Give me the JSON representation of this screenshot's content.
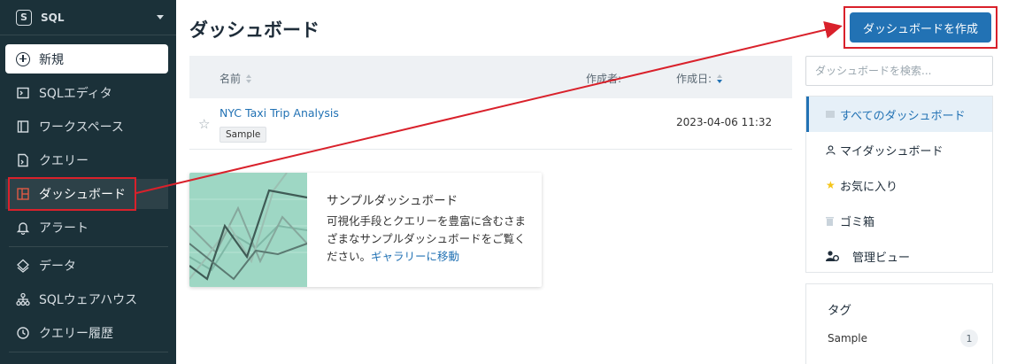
{
  "sidebar": {
    "workspace_label": "SQL",
    "new_label": "新規",
    "items": [
      {
        "label": "SQLエディタ",
        "icon": "sql-editor-icon"
      },
      {
        "label": "ワークスペース",
        "icon": "workspace-icon"
      },
      {
        "label": "クエリー",
        "icon": "query-icon"
      },
      {
        "label": "ダッシュボード",
        "icon": "dashboard-icon",
        "active": true
      },
      {
        "label": "アラート",
        "icon": "bell-icon"
      },
      {
        "label": "データ",
        "icon": "data-icon"
      },
      {
        "label": "SQLウェアハウス",
        "icon": "warehouse-icon"
      },
      {
        "label": "クエリー履歴",
        "icon": "history-icon"
      }
    ]
  },
  "main": {
    "title": "ダッシュボード",
    "create_button": "ダッシュボードを作成",
    "table": {
      "columns": {
        "name": "名前",
        "author": "作成者:",
        "created": "作成日:"
      },
      "rows": [
        {
          "title": "NYC Taxi Trip Analysis",
          "tag": "Sample",
          "created": "2023-04-06 11:32"
        }
      ]
    },
    "sample_card": {
      "title": "サンプルダッシュボード",
      "description": "可視化手段とクエリーを豊富に含むさまざまなサンプルダッシュボードをご覧ください。",
      "link": "ギャラリーに移動"
    },
    "search": {
      "placeholder": "ダッシュボードを検索..."
    },
    "filters": [
      {
        "label": "すべてのダッシュボード",
        "icon": "list-icon",
        "active": true
      },
      {
        "label": "マイダッシュボード",
        "icon": "user-icon"
      },
      {
        "label": "お気に入り",
        "icon": "star-icon"
      },
      {
        "label": "ゴミ箱",
        "icon": "trash-icon"
      },
      {
        "label": "管理ビュー",
        "icon": "admin-icon"
      }
    ],
    "tags": {
      "heading": "タグ",
      "items": [
        {
          "label": "Sample",
          "count": "1"
        }
      ]
    }
  },
  "colors": {
    "sidebar_bg": "#1b3139",
    "primary": "#2272b4",
    "annotation": "#d9212b",
    "favorite_star": "#f5c518"
  }
}
